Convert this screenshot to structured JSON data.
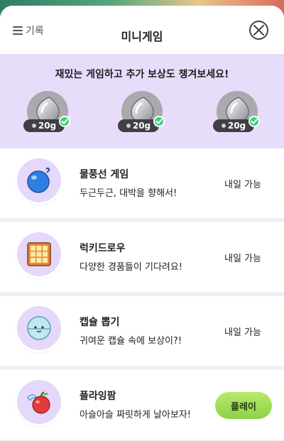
{
  "header": {
    "history_label": "기록",
    "title": "미니게임"
  },
  "banner": {
    "message": "재밌는 게임하고 추가 보상도 챙겨보세요!",
    "rewards": [
      {
        "amount": "20g",
        "claimed": true
      },
      {
        "amount": "20g",
        "claimed": true
      },
      {
        "amount": "20g",
        "claimed": true
      }
    ]
  },
  "games": [
    {
      "name": "물풍선 게임",
      "desc": "두근두근, 대박을 향해서!",
      "status": "내일 가능",
      "icon": "water-balloon-icon"
    },
    {
      "name": "럭키드로우",
      "desc": "다양한 경품들이 기다려요!",
      "status": "내일 가능",
      "icon": "lucky-draw-grid-icon"
    },
    {
      "name": "캡슐 뽑기",
      "desc": "귀여운 캡슐 속에 보상이?!",
      "status": "내일 가능",
      "icon": "capsule-icon"
    },
    {
      "name": "플라잉팜",
      "desc": "아슬아슬 짜릿하게 날아보자!",
      "action": "플레이",
      "icon": "flying-apple-icon"
    }
  ],
  "colors": {
    "banner_bg": "#e8dcfb",
    "icon_bg": "#e5d8fa",
    "play_button": "#9ddc55",
    "check": "#3bd17a"
  }
}
